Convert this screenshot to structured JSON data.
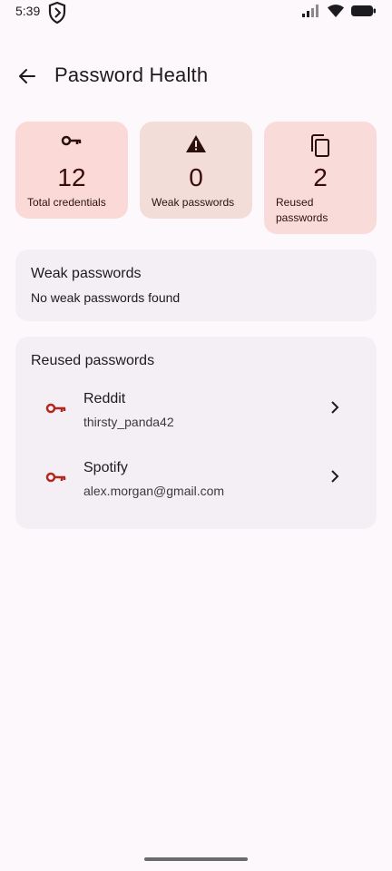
{
  "status_bar": {
    "time": "5:39"
  },
  "header": {
    "title": "Password Health"
  },
  "stats": [
    {
      "value": "12",
      "label": "Total credentials",
      "icon": "key-icon",
      "color": "#fbd9d6"
    },
    {
      "value": "0",
      "label": "Weak passwords",
      "icon": "warning-icon",
      "color": "#f2ddd8"
    },
    {
      "value": "2",
      "label": "Reused passwords",
      "icon": "copy-icon",
      "color": "#f9dcd9"
    }
  ],
  "weak_section": {
    "title": "Weak passwords",
    "message": "No weak passwords found"
  },
  "reused_section": {
    "title": "Reused passwords",
    "items": [
      {
        "name": "Reddit",
        "username": "thirsty_panda42",
        "icon": "key-icon"
      },
      {
        "name": "Spotify",
        "username": "alex.morgan@gmail.com",
        "icon": "key-icon"
      }
    ]
  },
  "colors": {
    "background": "#fdf8fb",
    "card": "#f4eff4",
    "accent_key": "#b3261e"
  }
}
